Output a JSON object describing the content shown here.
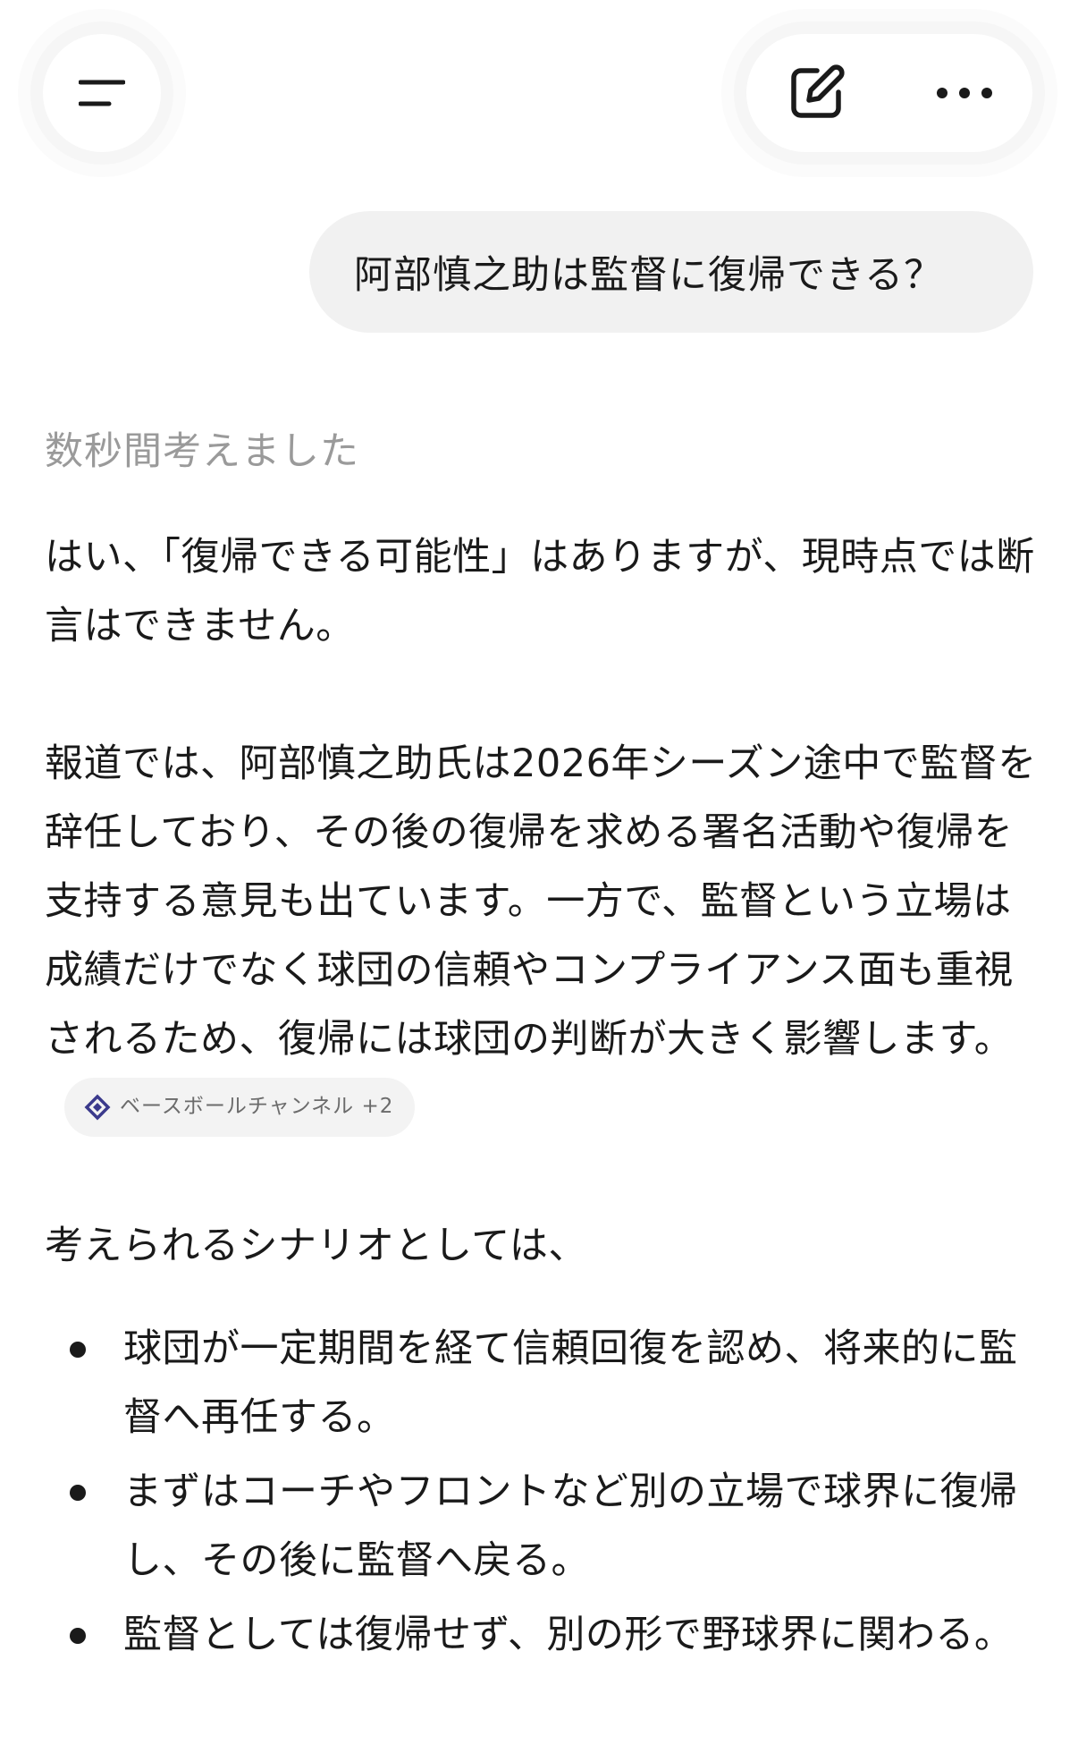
{
  "header": {
    "menu_icon": "menu-icon",
    "edit_icon": "new-chat-edit-icon",
    "more_icon": "more-dots-icon"
  },
  "user_message": "阿部慎之助は監督に復帰できる？",
  "thought_label": "数秒間考えました",
  "answer": {
    "p1": "はい、「復帰できる可能性」はありますが、現時点では断言はできません。",
    "p2": "報道では、阿部慎之助氏は2026年シーズン途中で監督を辞任しており、その後の復帰を求める署名活動や復帰を支持する意見も出ています。一方で、監督という立場は成績だけでなく球団の信頼やコンプライアンス面も重視されるため、復帰には球団の判断が大きく影響します。",
    "source_chip": "ベースボールチャンネル +2",
    "p3": "考えられるシナリオとしては、",
    "scenarios": [
      "球団が一定期間を経て信頼回復を認め、将来的に監督へ再任する。",
      "まずはコーチやフロントなど別の立場で球界に復帰し、その後に監督へ戻る。",
      "監督としては復帰せず、別の形で野球界に関わる。"
    ]
  },
  "colors": {
    "bubble_bg": "#f1f1f1",
    "muted_text": "#9a9a9a",
    "chip_icon": "#3b3a8c"
  }
}
